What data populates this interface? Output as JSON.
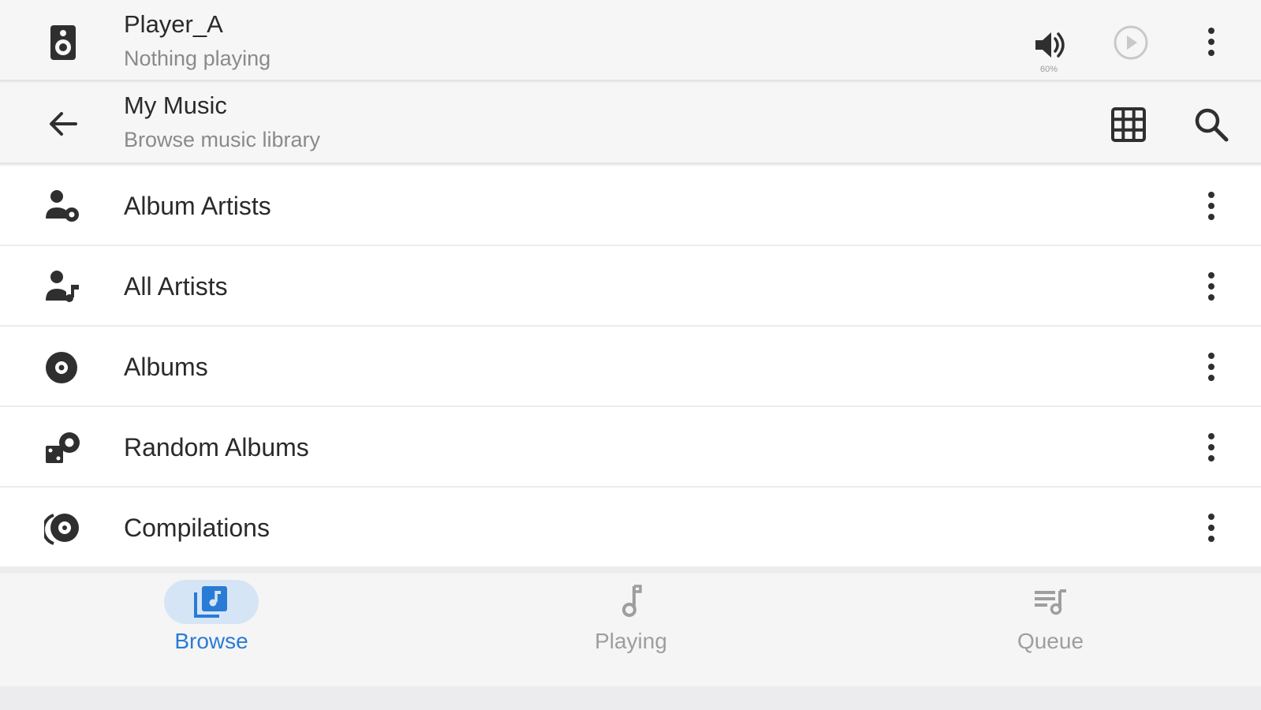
{
  "player": {
    "name": "Player_A",
    "status": "Nothing playing",
    "volume_percent": "60%",
    "icons": {
      "lead": "speaker-icon",
      "volume": "volume-icon",
      "play": "play-circle-icon",
      "menu": "more-vert-icon"
    }
  },
  "browse_header": {
    "title": "My Music",
    "subtitle": "Browse music library",
    "icons": {
      "back": "arrow-back-icon",
      "grid": "grid-view-icon",
      "search": "search-icon"
    }
  },
  "list": {
    "items": [
      {
        "label": "Album Artists",
        "icon": "album-artist-icon"
      },
      {
        "label": "All Artists",
        "icon": "all-artists-icon"
      },
      {
        "label": "Albums",
        "icon": "album-disc-icon"
      },
      {
        "label": "Random Albums",
        "icon": "random-albums-icon"
      },
      {
        "label": "Compilations",
        "icon": "compilations-icon"
      }
    ]
  },
  "nav": {
    "tabs": [
      {
        "label": "Browse",
        "icon": "library-music-icon",
        "active": true
      },
      {
        "label": "Playing",
        "icon": "music-note-icon",
        "active": false
      },
      {
        "label": "Queue",
        "icon": "queue-music-icon",
        "active": false
      }
    ]
  },
  "colors": {
    "accent": "#2a7bd6",
    "accent_pill": "#d6e5f6",
    "header_bg": "#f6f6f6",
    "list_bg": "#ffffff",
    "icon": "#2f2f2f",
    "muted": "#9e9e9e"
  }
}
